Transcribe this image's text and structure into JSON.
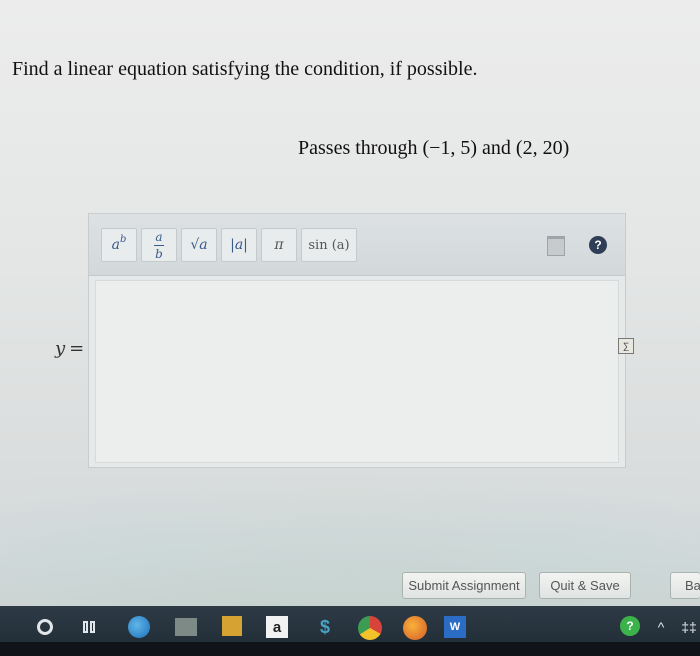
{
  "question": "Find a linear equation satisfying the condition, if possible.",
  "condition": "Passes through (−1, 5) and (2, 20)",
  "toolbar": {
    "power_base": "a",
    "power_exp": "b",
    "fraction_num": "a",
    "fraction_den": "b",
    "sqrt_label": "√a",
    "abs_label": "|a|",
    "pi_label": "π",
    "sin_label": "sin (a)",
    "trash_icon": "trash-icon",
    "help_label": "?"
  },
  "answer": {
    "variable": "y",
    "equals": "=",
    "value": ""
  },
  "buttons": {
    "submit": "Submit Assignment",
    "quit": "Quit & Save",
    "back": "Ba"
  },
  "taskbar": {
    "amazon_label": "a",
    "money_label": "$",
    "word_label": "W",
    "help_label": "?",
    "chevron": "^",
    "more": "‡‡"
  },
  "colors": {
    "toolbar_bg": "#d8dcde",
    "help_icon": "#2f3d57",
    "taskbar": "#24313b"
  }
}
